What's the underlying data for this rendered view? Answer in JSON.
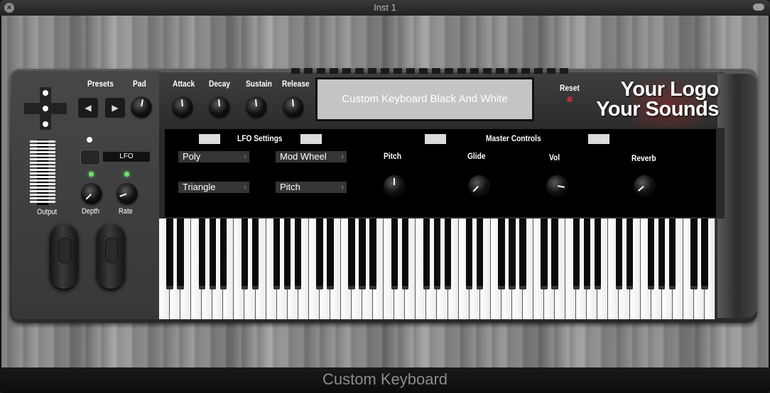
{
  "window": {
    "title": "Inst 1",
    "footer": "Custom Keyboard"
  },
  "header": {
    "presets_label": "Presets",
    "pad_label": "Pad",
    "attack_label": "Attack",
    "decay_label": "Decay",
    "sustain_label": "Sustain",
    "release_label": "Release",
    "display_text": "Custom Keyboard Black And White",
    "reset_label": "Reset",
    "logo_line1": "Your Logo",
    "logo_line2": "Your Sounds"
  },
  "left": {
    "lfo_button_label": "LFO",
    "output_label": "Output",
    "depth_label": "Depth",
    "rate_label": "Rate"
  },
  "lfo": {
    "title": "LFO Settings",
    "mode_value": "Poly",
    "wave_value": "Triangle",
    "source_value": "Mod Wheel",
    "target_value": "Pitch"
  },
  "master": {
    "title": "Master Controls",
    "pitch_label": "Pitch",
    "glide_label": "Glide",
    "vol_label": "Vol",
    "reverb_label": "Reverb"
  },
  "colors": {
    "led_green": "#6de06d",
    "display_bg": "#c4c4c4",
    "reset_red": "#aa3333"
  },
  "keyboard": {
    "white_keys": 52
  }
}
